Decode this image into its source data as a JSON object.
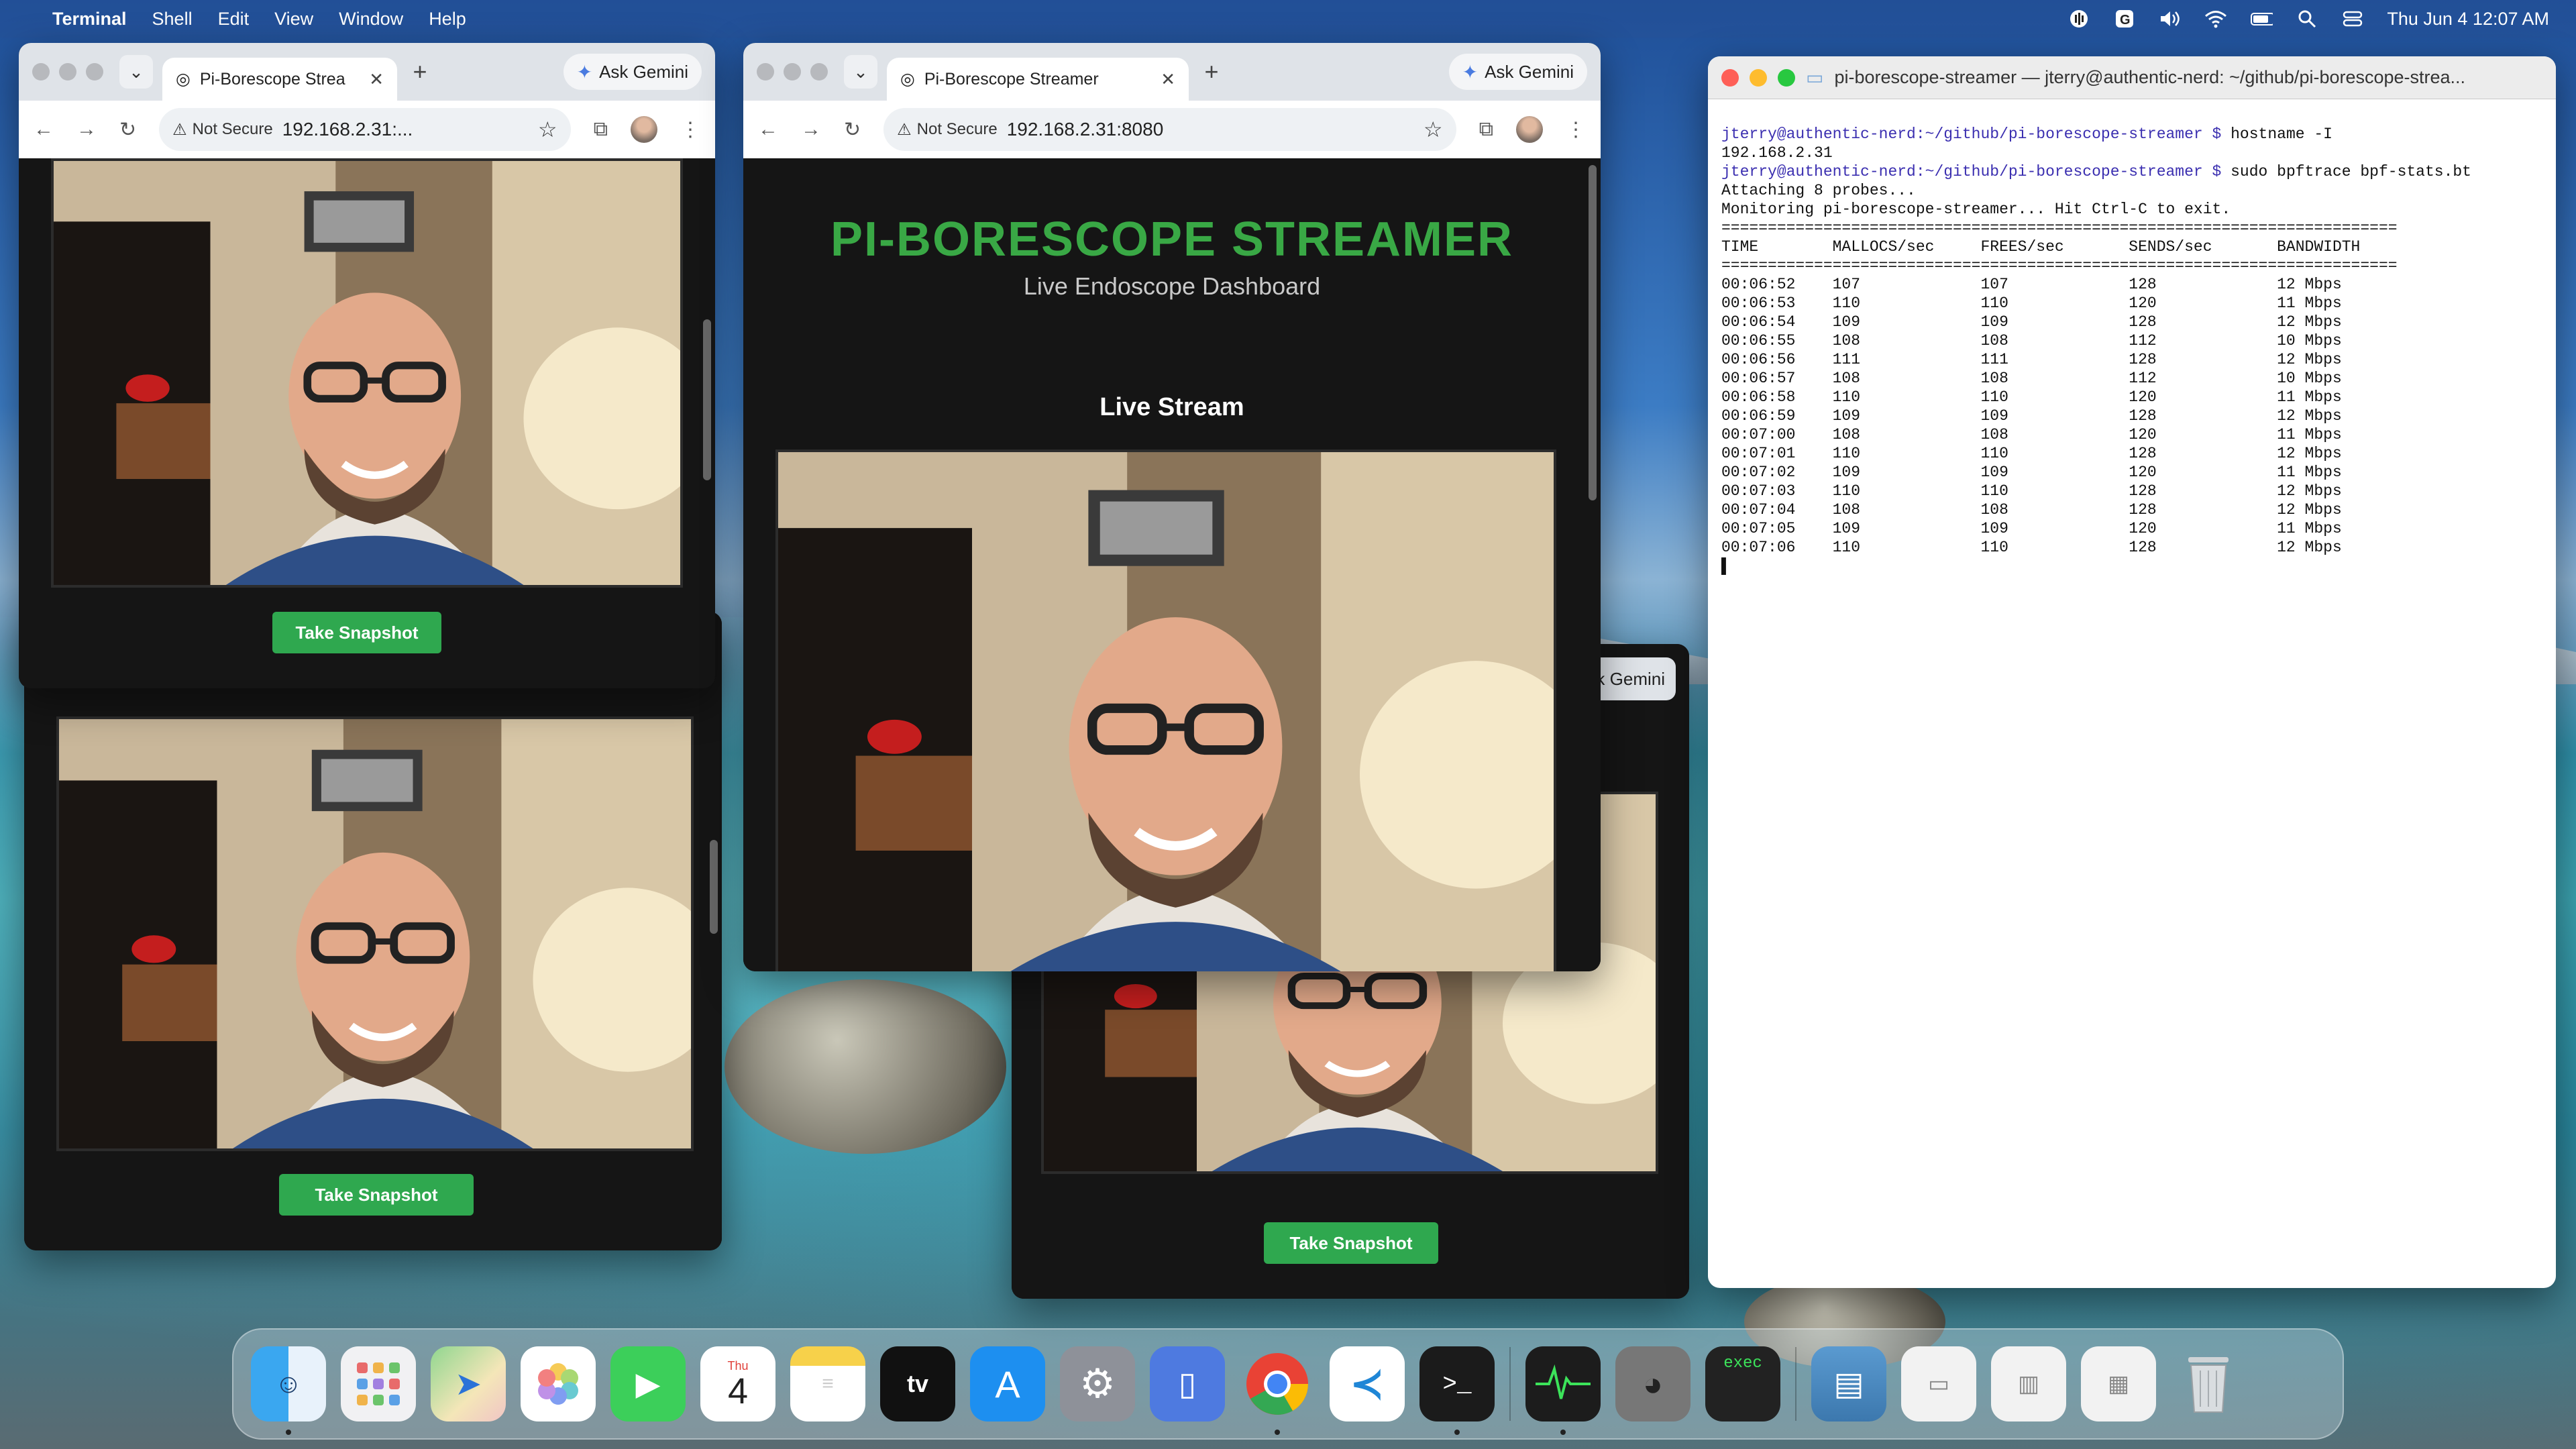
{
  "menubar": {
    "app": "Terminal",
    "menus": [
      "Shell",
      "Edit",
      "View",
      "Window",
      "Help"
    ],
    "clock": "Thu Jun 4  12:07 AM"
  },
  "browser_tab": {
    "title_full": "Pi-Borescope Streamer",
    "title_trunc": "Pi-Borescope Strea",
    "ask_gemini": "Ask Gemini",
    "ask_gemini_cut": "sk Gemini",
    "not_secure": "Not Secure",
    "url_full": "192.168.2.31:8080",
    "url_trunc": "192.168.2.31:..."
  },
  "dashboard": {
    "title": "PI-BORESCOPE STREAMER",
    "subtitle": "Live Endoscope Dashboard",
    "live_heading": "Live Stream",
    "snapshot_label": "Take Snapshot"
  },
  "terminal": {
    "title": "pi-borescope-streamer — jterry@authentic-nerd: ~/github/pi-borescope-strea...",
    "prompt": "jterry@authentic-nerd:~/github/pi-borescope-streamer $",
    "cmd1": " hostname -I",
    "out1": "192.168.2.31",
    "cmd2": " sudo bpftrace bpf-stats.bt",
    "out2": "Attaching 8 probes...",
    "out3": "Monitoring pi-borescope-streamer... Hit Ctrl-C to exit.",
    "rule": "=========================================================================",
    "headers": [
      "TIME",
      "MALLOCS/sec",
      "FREES/sec",
      "SENDS/sec",
      "BANDWIDTH"
    ],
    "rows": [
      [
        "00:06:52",
        "107",
        "107",
        "128",
        "12 Mbps"
      ],
      [
        "00:06:53",
        "110",
        "110",
        "120",
        "11 Mbps"
      ],
      [
        "00:06:54",
        "109",
        "109",
        "128",
        "12 Mbps"
      ],
      [
        "00:06:55",
        "108",
        "108",
        "112",
        "10 Mbps"
      ],
      [
        "00:06:56",
        "111",
        "111",
        "128",
        "12 Mbps"
      ],
      [
        "00:06:57",
        "108",
        "108",
        "112",
        "10 Mbps"
      ],
      [
        "00:06:58",
        "110",
        "110",
        "120",
        "11 Mbps"
      ],
      [
        "00:06:59",
        "109",
        "109",
        "128",
        "12 Mbps"
      ],
      [
        "00:07:00",
        "108",
        "108",
        "120",
        "11 Mbps"
      ],
      [
        "00:07:01",
        "110",
        "110",
        "128",
        "12 Mbps"
      ],
      [
        "00:07:02",
        "109",
        "109",
        "120",
        "11 Mbps"
      ],
      [
        "00:07:03",
        "110",
        "110",
        "128",
        "12 Mbps"
      ],
      [
        "00:07:04",
        "108",
        "108",
        "128",
        "12 Mbps"
      ],
      [
        "00:07:05",
        "109",
        "109",
        "120",
        "11 Mbps"
      ],
      [
        "00:07:06",
        "110",
        "110",
        "128",
        "12 Mbps"
      ]
    ]
  },
  "dock": {
    "calendar_month": "Thu",
    "calendar_day": "4",
    "tv_label": "tv",
    "exec_label": "exec",
    "terminal_glyph": ">_",
    "items": [
      "finder-icon",
      "launchpad-icon",
      "maps-icon",
      "photos-icon",
      "facetime-icon",
      "calendar-icon",
      "notes-icon",
      "apple-tv-icon",
      "app-store-icon",
      "system-settings-icon",
      "simulator-icon",
      "chrome-icon",
      "vscode-icon",
      "terminal-icon",
      "activity-monitor-icon",
      "gimp-icon",
      "exec-icon",
      "folder-stack-icon",
      "chrome-window-thumb-icon",
      "window-thumb-icon",
      "activity-window-thumb-icon",
      "trash-icon"
    ]
  },
  "colors": {
    "accent_green": "#2fa84f",
    "title_green": "#39a845",
    "prompt_purple": "#3b2fb0"
  }
}
